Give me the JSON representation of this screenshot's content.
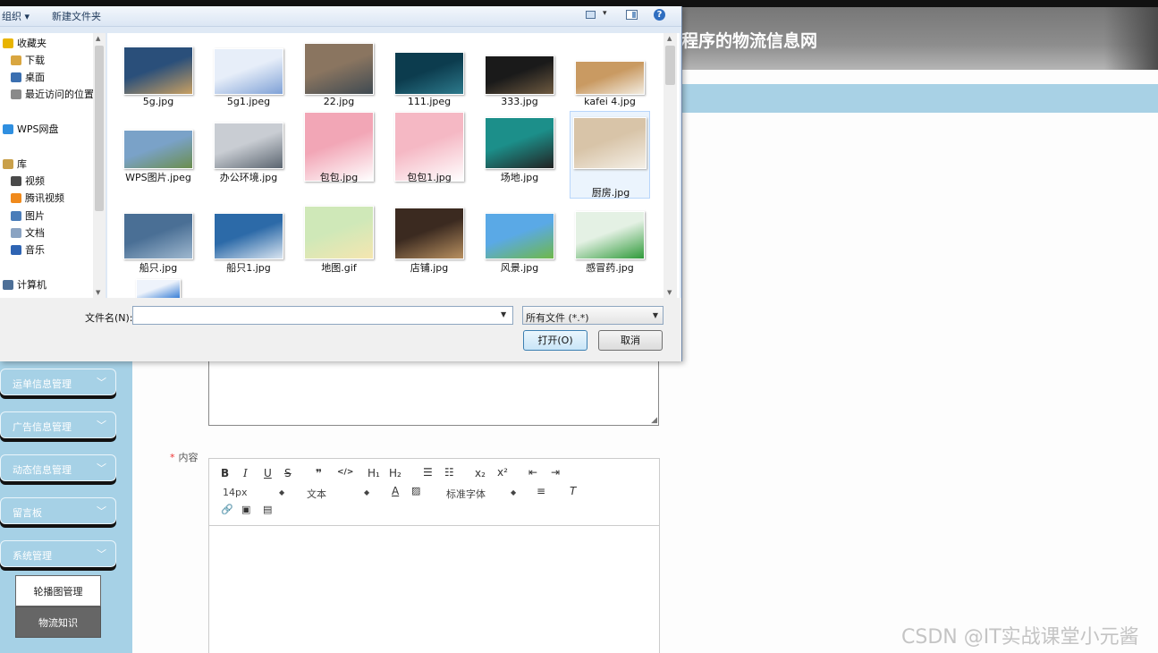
{
  "page": {
    "header_title": "程序的物流信息网",
    "sidebar_menu": [
      {
        "label": "运单信息管理"
      },
      {
        "label": "广告信息管理"
      },
      {
        "label": "动态信息管理"
      },
      {
        "label": "留言板"
      },
      {
        "label": "系统管理"
      }
    ],
    "submenu": [
      {
        "label": "轮播图管理"
      },
      {
        "label": "物流知识"
      }
    ],
    "content_label_required": "*",
    "content_label": "内容",
    "editor": {
      "font_size": "14px",
      "block_type": "文本",
      "font_family": "标准字体",
      "bold": "B",
      "italic": "I",
      "underline": "U",
      "strike": "S",
      "quote": "❞",
      "code": "</>",
      "h1": "H₁",
      "h2": "H₂",
      "subscript": "x₂",
      "superscript": "x²"
    },
    "watermark": "CSDN @IT实战课堂小元酱"
  },
  "dialog": {
    "toolbar": {
      "organize": "组织 ▾",
      "new_folder": "新建文件夹"
    },
    "nav": [
      {
        "label": "收藏夹",
        "icon": "star-icon",
        "color": "#e8b400"
      },
      {
        "label": "下载",
        "icon": "download-folder-icon",
        "color": "#d9a640"
      },
      {
        "label": "桌面",
        "icon": "desktop-icon",
        "color": "#3b6fb0"
      },
      {
        "label": "最近访问的位置",
        "icon": "recent-places-icon",
        "color": "#8a8a8a"
      },
      {
        "label": "WPS网盘",
        "icon": "cloud-icon",
        "color": "#2f8fe0"
      },
      {
        "label": "库",
        "icon": "library-icon",
        "color": "#c9a04a"
      },
      {
        "label": "视频",
        "icon": "video-icon",
        "color": "#4a4a4a"
      },
      {
        "label": "腾讯视频",
        "icon": "tencent-video-icon",
        "color": "#f08a1c"
      },
      {
        "label": "图片",
        "icon": "pictures-icon",
        "color": "#4b7db9"
      },
      {
        "label": "文档",
        "icon": "documents-icon",
        "color": "#8aa3c2"
      },
      {
        "label": "音乐",
        "icon": "music-icon",
        "color": "#2e64b3"
      },
      {
        "label": "计算机",
        "icon": "computer-icon",
        "color": "#4d6f97"
      }
    ],
    "files": [
      {
        "name": "5g.jpg",
        "colors": [
          "#2a4f7a",
          "#c9a062"
        ]
      },
      {
        "name": "5g1.jpeg",
        "colors": [
          "#e7eef9",
          "#7fa1d6"
        ]
      },
      {
        "name": "22.jpg",
        "colors": [
          "#8a7560",
          "#3f4a52"
        ]
      },
      {
        "name": "111.jpeg",
        "colors": [
          "#0c3c4e",
          "#2d7a8c"
        ]
      },
      {
        "name": "333.jpg",
        "colors": [
          "#1a1a1a",
          "#6e5a40"
        ]
      },
      {
        "name": "kafei 4.jpg",
        "colors": [
          "#c99a62",
          "#f2ece0"
        ]
      },
      {
        "name": "WPS图片.jpeg",
        "colors": [
          "#7aa2c8",
          "#6b8e4e"
        ]
      },
      {
        "name": "办公环境.jpg",
        "colors": [
          "#c9cdd3",
          "#5b6570"
        ]
      },
      {
        "name": "包包.jpg",
        "colors": [
          "#f2a6b6",
          "#ffffff"
        ]
      },
      {
        "name": "包包1.jpg",
        "colors": [
          "#f5b8c4",
          "#ffffff"
        ]
      },
      {
        "name": "场地.jpg",
        "colors": [
          "#1c8f8a",
          "#222222"
        ]
      },
      {
        "name": "厨房.jpg",
        "colors": [
          "#d8c4a8",
          "#f4efe6"
        ]
      },
      {
        "name": "船只.jpg",
        "colors": [
          "#4a6f95",
          "#9fb8cf"
        ]
      },
      {
        "name": "船只1.jpg",
        "colors": [
          "#2c6aa8",
          "#d8e4f0"
        ]
      },
      {
        "name": "地图.gif",
        "colors": [
          "#cfe8b8",
          "#f5e6b0"
        ]
      },
      {
        "name": "店铺.jpg",
        "colors": [
          "#3b2a20",
          "#b89060"
        ]
      },
      {
        "name": "风景.jpg",
        "colors": [
          "#5aa9e6",
          "#6fb84a"
        ]
      },
      {
        "name": "感冒药.jpg",
        "colors": [
          "#e4f1e4",
          "#2f9a3a"
        ]
      },
      {
        "name": "",
        "colors": [
          "#eef3fb",
          "#3a7fd6"
        ]
      }
    ],
    "filename_label": "文件名(N):",
    "filename_value": "",
    "filetype": "所有文件 (*.*)",
    "open_button": "打开(O)",
    "cancel_button": "取消"
  }
}
